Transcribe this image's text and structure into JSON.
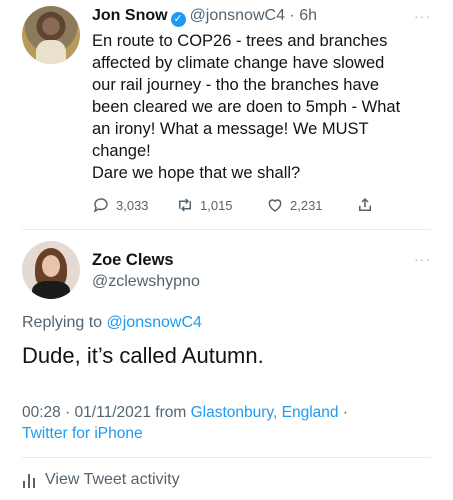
{
  "tweet1": {
    "name": "Jon Snow",
    "handle": "@jonsnowC4",
    "separator": "·",
    "time": "6h",
    "more": "···",
    "lines": [
      "En route to COP26 - trees and branches",
      "affected by climate change have slowed",
      "our rail journey - tho the branches have",
      "been cleared we are doen to 5mph - What",
      "an irony! What a message! We MUST",
      "change!",
      "Dare we hope that we shall?"
    ],
    "replies": "3,033",
    "retweets": "1,015",
    "likes": "2,231"
  },
  "tweet2": {
    "name": "Zoe Clews",
    "handle": "@zclewshypno",
    "more": "···",
    "replying_prefix": "Replying to",
    "replying_handle": "@jonsnowC4",
    "text": "Dude, it’s called Autumn.",
    "timestamp": "00:28 · 01/11/2021 from",
    "location": "Glastonbury, England",
    "meta_sep": " ·",
    "client": "Twitter for iPhone",
    "activity": "View Tweet activity"
  },
  "colors": {
    "accent": "#1d9bf0",
    "muted": "#536471"
  }
}
